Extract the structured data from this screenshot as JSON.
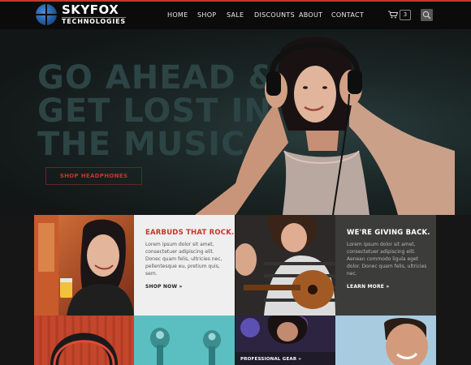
{
  "logo": {
    "line1": "SKYFOX",
    "line2": "TECHNOLOGIES"
  },
  "nav": {
    "items": [
      "HOME",
      "SHOP",
      "SALE",
      "DISCOUNTS",
      "ABOUT",
      "CONTACT"
    ]
  },
  "cart": {
    "count": "3",
    "icon": "cart-icon"
  },
  "search": {
    "icon": "search-icon"
  },
  "hero": {
    "headline": [
      "GO AHEAD &",
      "GET LOST IN",
      "THE MUSIC."
    ],
    "button": "SHOP HEADPHONES"
  },
  "tiles": {
    "earbuds": {
      "title": "EARBUDS THAT ROCK.",
      "body": "Lorem ipsum dolor sit amet, consectetuer adipiscing elit. Donec quam felis, ultricies nec, pellentesque eu, pretium quis, sem.",
      "link": "SHOP NOW »"
    },
    "giving": {
      "title": "WE'RE GIVING BACK.",
      "body": "Lorem ipsum dolor sit amet, consectetuer adipiscing elit. Aenean commodo ligula eget dolor. Donec quam felis, ultricies nec.",
      "link": "LEARN MORE »"
    },
    "pro": {
      "label": "PROFESSIONAL GEAR »"
    }
  },
  "colors": {
    "accent": "#c0392b",
    "header": "#0b0b0b"
  }
}
